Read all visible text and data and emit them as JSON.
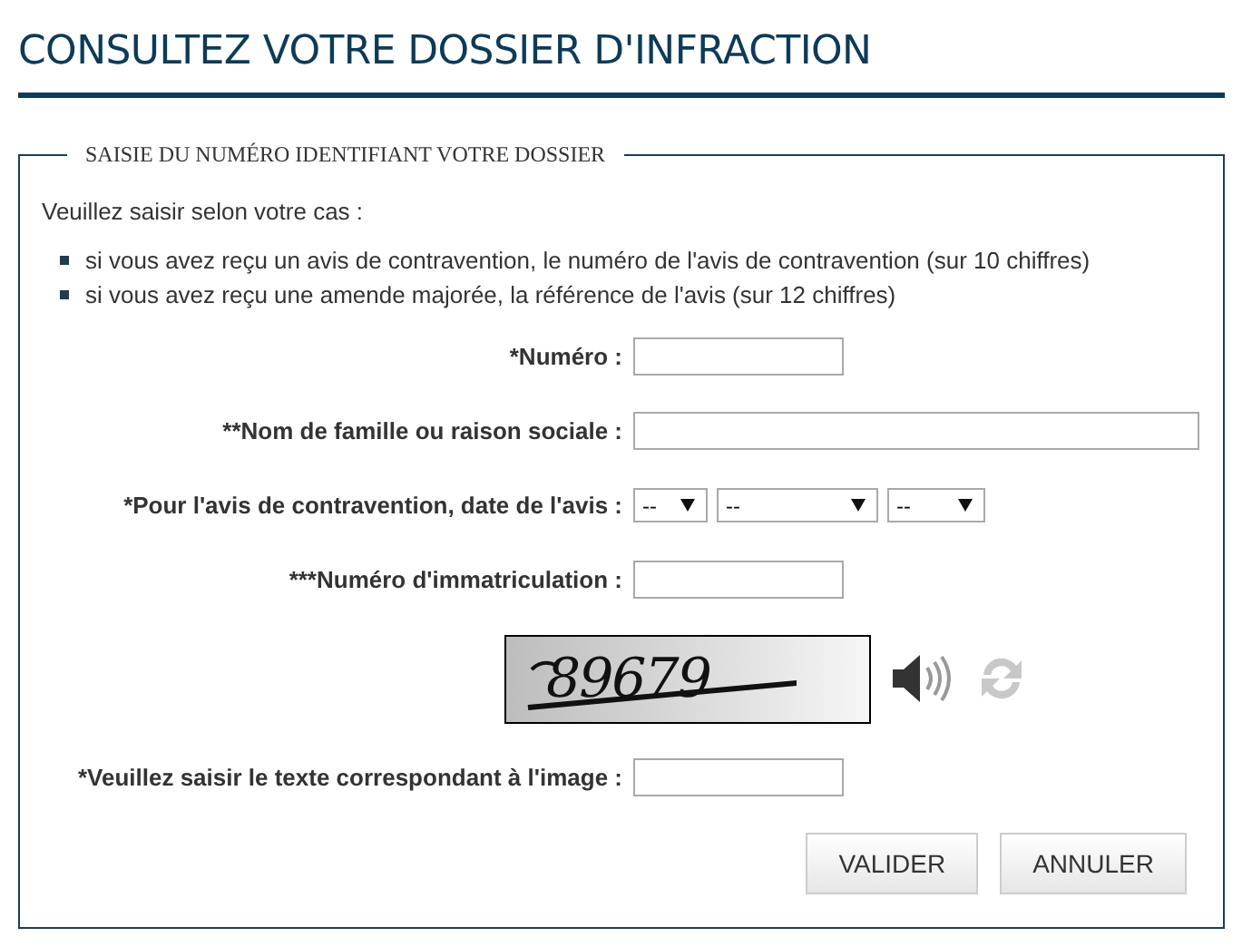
{
  "page_title": "CONSULTEZ VOTRE DOSSIER D'INFRACTION",
  "fieldset": {
    "legend": "SAISIE DU NUMÉRO IDENTIFIANT VOTRE DOSSIER",
    "intro": "Veuillez saisir selon votre cas :",
    "bullets": [
      "si vous avez reçu un avis de contravention, le numéro de l'avis de contravention (sur 10 chiffres)",
      "si vous avez reçu une amende majorée, la référence de l'avis (sur 12 chiffres)"
    ],
    "rows": [
      {
        "kind": "input",
        "label": "*Numéro :"
      },
      {
        "kind": "input",
        "label": "**Nom de famille ou raison sociale :"
      },
      {
        "kind": "date",
        "label": "*Pour l'avis de contravention, date de l'avis :",
        "selects": [
          "--",
          "--",
          "--"
        ]
      },
      {
        "kind": "input",
        "label": "***Numéro d'immatriculation :"
      },
      {
        "kind": "captcha",
        "captcha_text": "89679"
      },
      {
        "kind": "input",
        "label": "*Veuillez saisir le texte correspondant à l'image :"
      }
    ],
    "buttons": [
      "VALIDER",
      "ANNULER"
    ]
  }
}
